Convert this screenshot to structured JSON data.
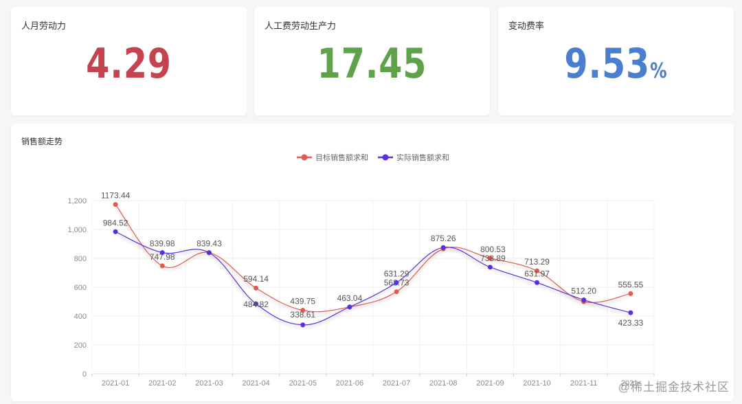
{
  "kpis": [
    {
      "title": "人月劳动力",
      "value": "4.29",
      "unit": "",
      "color": "#c5424f"
    },
    {
      "title": "人工费劳动生产力",
      "value": "17.45",
      "unit": "",
      "color": "#5ea24a"
    },
    {
      "title": "变动费率",
      "value": "9.53",
      "unit": "%",
      "color": "#4a7fd0"
    }
  ],
  "chart_panel": {
    "title": "销售额走势"
  },
  "chart_data": {
    "type": "line",
    "smooth": true,
    "categories": [
      "2021-01",
      "2021-02",
      "2021-03",
      "2021-04",
      "2021-05",
      "2021-06",
      "2021-07",
      "2021-08",
      "2021-09",
      "2021-10",
      "2021-11",
      "2021-12"
    ],
    "x_tick_labels": [
      "2021-01",
      "2021-02",
      "2021-03",
      "2021-04",
      "2021-05",
      "2021-06",
      "2021-07",
      "2021-08",
      "2021-09",
      "2021-10",
      "2021-11",
      "2021-"
    ],
    "ylim": [
      0,
      1200
    ],
    "y_ticks": [
      {
        "value": 0,
        "label": "0"
      },
      {
        "value": 200,
        "label": "200"
      },
      {
        "value": 400,
        "label": "400"
      },
      {
        "value": 600,
        "label": "600"
      },
      {
        "value": 800,
        "label": "800"
      },
      {
        "value": 1000,
        "label": "1,000"
      },
      {
        "value": 1200,
        "label": "1,200"
      }
    ],
    "grid": true,
    "legend_position": "top-center",
    "series": [
      {
        "name": "目标销售额求和",
        "color": "#e05a4e",
        "values": [
          1173.44,
          747.98,
          839.43,
          594.14,
          439.75,
          463.04,
          568.73,
          866.0,
          800.53,
          713.29,
          500.0,
          555.55
        ],
        "labels": [
          "1173.44",
          "747.98",
          "",
          "594.14",
          "439.75",
          "",
          "568.73",
          "",
          "800.53",
          "713.29",
          "",
          "555.55"
        ]
      },
      {
        "name": "实际销售额求和",
        "color": "#5b2ee0",
        "values": [
          984.52,
          839.98,
          839.43,
          484.82,
          338.61,
          463.04,
          631.29,
          875.26,
          738.89,
          631.97,
          512.2,
          423.33
        ],
        "labels": [
          "984.52",
          "839.98",
          "839.43",
          "484.82",
          "338.61",
          "463.04",
          "631.29",
          "875.26",
          "738.89",
          "631.97",
          "512.20",
          "423.33"
        ]
      }
    ]
  },
  "watermark": "@稀土掘金技术社区"
}
